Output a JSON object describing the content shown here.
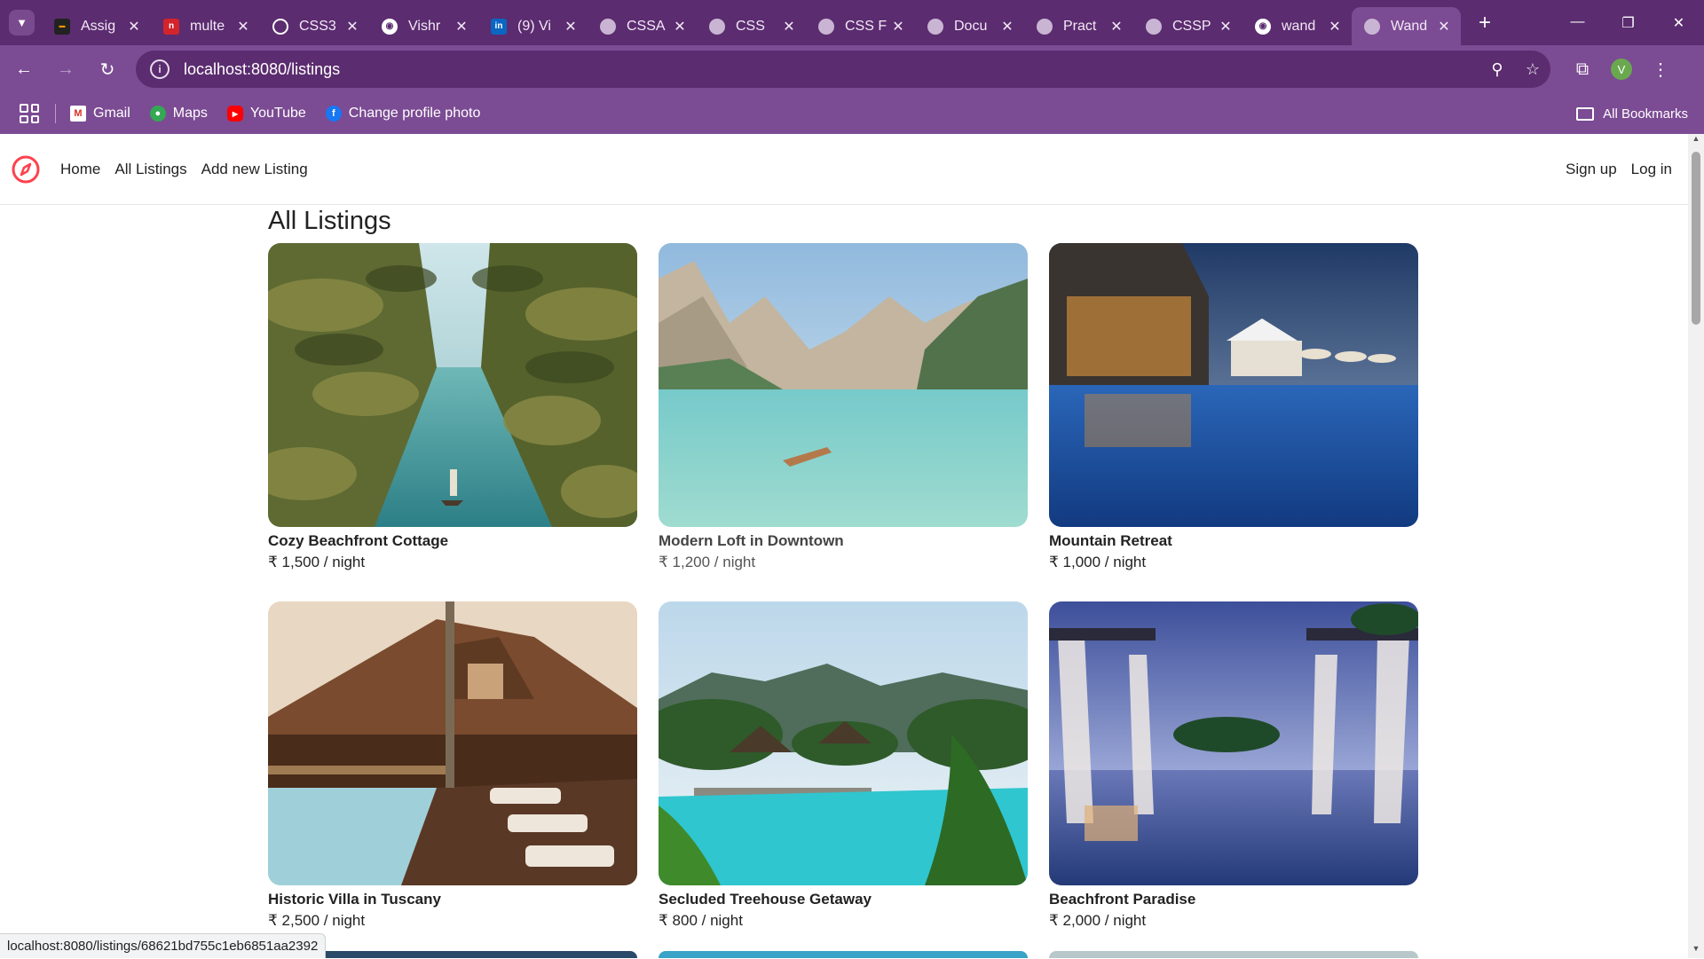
{
  "browser": {
    "tabs": [
      {
        "title": "Assig",
        "icon": "page-favicon"
      },
      {
        "title": "multe",
        "icon": "page-favicon"
      },
      {
        "title": "CSS3",
        "icon": "openai-icon"
      },
      {
        "title": "Vishr",
        "icon": "github-icon"
      },
      {
        "title": "(9) Vi",
        "icon": "linkedin-icon"
      },
      {
        "title": "CSSA",
        "icon": "globe-icon"
      },
      {
        "title": "CSS",
        "icon": "globe-icon"
      },
      {
        "title": "CSS F",
        "icon": "globe-icon"
      },
      {
        "title": "Docu",
        "icon": "globe-icon"
      },
      {
        "title": "Pract",
        "icon": "globe-icon"
      },
      {
        "title": "CSSP",
        "icon": "globe-icon"
      },
      {
        "title": "wand",
        "icon": "github-icon"
      },
      {
        "title": "Wand",
        "icon": "globe-icon",
        "active": true
      }
    ],
    "url": "localhost:8080/listings",
    "avatar_letter": "V",
    "bookmarks": [
      {
        "label": "Gmail",
        "icon": "gmail-icon"
      },
      {
        "label": "Maps",
        "icon": "maps-icon"
      },
      {
        "label": "YouTube",
        "icon": "youtube-icon"
      },
      {
        "label": "Change profile photo",
        "icon": "facebook-icon"
      }
    ],
    "all_bookmarks": "All Bookmarks",
    "status_url": "localhost:8080/listings/68621bd755c1eb6851aa2392"
  },
  "site": {
    "nav": {
      "home": "Home",
      "all_listings": "All Listings",
      "add_listing": "Add new Listing"
    },
    "auth": {
      "signup": "Sign up",
      "login": "Log in"
    },
    "page_title": "All Listings",
    "listings": [
      {
        "title": "Cozy Beachfront Cottage",
        "price": "₹ 1,500 / night"
      },
      {
        "title": "Modern Loft in Downtown",
        "price": "₹ 1,200 / night"
      },
      {
        "title": "Mountain Retreat",
        "price": "₹ 1,000 / night"
      },
      {
        "title": "Historic Villa in Tuscany",
        "price": "₹ 2,500 / night"
      },
      {
        "title": "Secluded Treehouse Getaway",
        "price": "₹ 800 / night"
      },
      {
        "title": "Beachfront Paradise",
        "price": "₹ 2,000 / night"
      }
    ]
  },
  "colors": {
    "chrome_dark": "#5b2c6f",
    "chrome_light": "#7b4b93",
    "brand": "#fe424d"
  }
}
